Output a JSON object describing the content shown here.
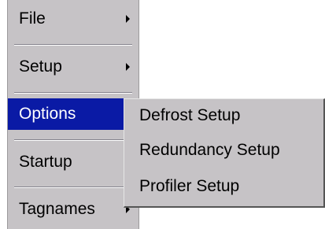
{
  "main_menu": {
    "items": [
      {
        "label": "File",
        "has_submenu": true
      },
      {
        "label": "Setup",
        "has_submenu": true
      },
      {
        "label": "Options",
        "has_submenu": false,
        "selected": true
      },
      {
        "label": "Startup",
        "has_submenu": false
      },
      {
        "label": "Tagnames",
        "has_submenu": true
      }
    ]
  },
  "submenu": {
    "items": [
      {
        "label": "Defrost Setup"
      },
      {
        "label": "Redundancy Setup"
      },
      {
        "label": "Profiler Setup"
      }
    ]
  },
  "colors": {
    "menu_background": "#c6c3c6",
    "selection_background": "#0a1aa5",
    "selection_text": "#ffffff",
    "text": "#000000"
  }
}
